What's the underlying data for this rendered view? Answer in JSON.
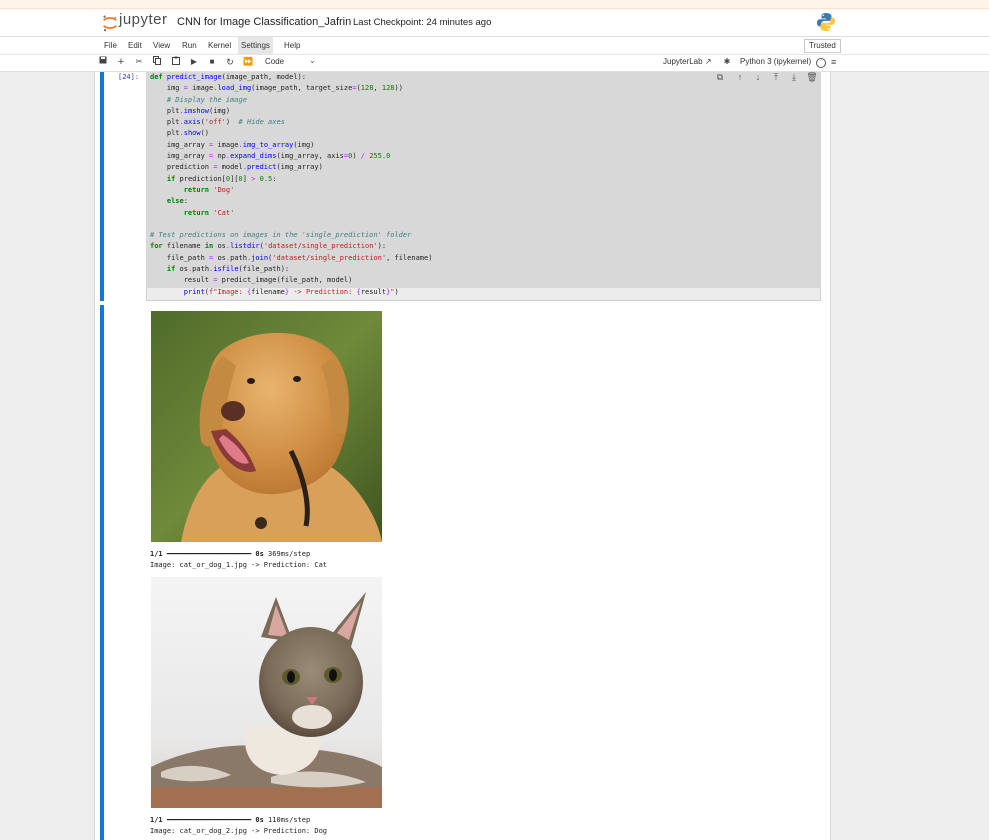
{
  "header": {
    "logo_text": "jupyter",
    "notebook_title": "CNN for Image Classification_Jafrin",
    "checkpoint": "Last Checkpoint: 24 minutes ago"
  },
  "menu": [
    "File",
    "Edit",
    "View",
    "Run",
    "Kernel",
    "Settings",
    "Help"
  ],
  "menu_active": "Settings",
  "trusted_label": "Trusted",
  "toolbar": {
    "cell_type": "Code",
    "jupyterlab_label": "JupyterLab",
    "kernel_name": "Python 3 (ipykernel)"
  },
  "cell": {
    "prompt": "[24]:",
    "code_lines": [
      "def predict_image(image_path, model):",
      "    img = image.load_img(image_path, target_size=(128, 128))",
      "    # Display the image",
      "    plt.imshow(img)",
      "    plt.axis('off')  # Hide axes",
      "    plt.show()",
      "    img_array = image.img_to_array(img)",
      "    img_array = np.expand_dims(img_array, axis=0) / 255.0",
      "    prediction = model.predict(img_array)",
      "    if prediction[0][0] > 0.5:",
      "        return 'Dog'",
      "    else:",
      "        return 'Cat'",
      "",
      "# Test predictions on images in the 'single_prediction' folder",
      "for filename in os.listdir('dataset/single_prediction'):",
      "    file_path = os.path.join('dataset/single_prediction', filename)",
      "    if os.path.isfile(file_path):",
      "        result = predict_image(file_path, model)",
      "        print(f\"Image: {filename} -> Prediction: {result}\")"
    ]
  },
  "outputs": [
    {
      "image": "dog-photo",
      "progress_count": "1/1",
      "progress_bar": "━━━━━━━━━━━━━━━━━━━━",
      "progress_time": "0s",
      "step_time": "369ms/step",
      "result_line": "Image: cat_or_dog_1.jpg -> Prediction: Cat"
    },
    {
      "image": "cat-photo",
      "progress_count": "1/1",
      "progress_bar": "━━━━━━━━━━━━━━━━━━━━",
      "progress_time": "0s",
      "step_time": "110ms/step",
      "result_line": "Image: cat_or_dog_2.jpg -> Prediction: Dog"
    }
  ],
  "colors": {
    "cell_accent": "#1976d2",
    "jupyter_orange": "#f37726"
  }
}
